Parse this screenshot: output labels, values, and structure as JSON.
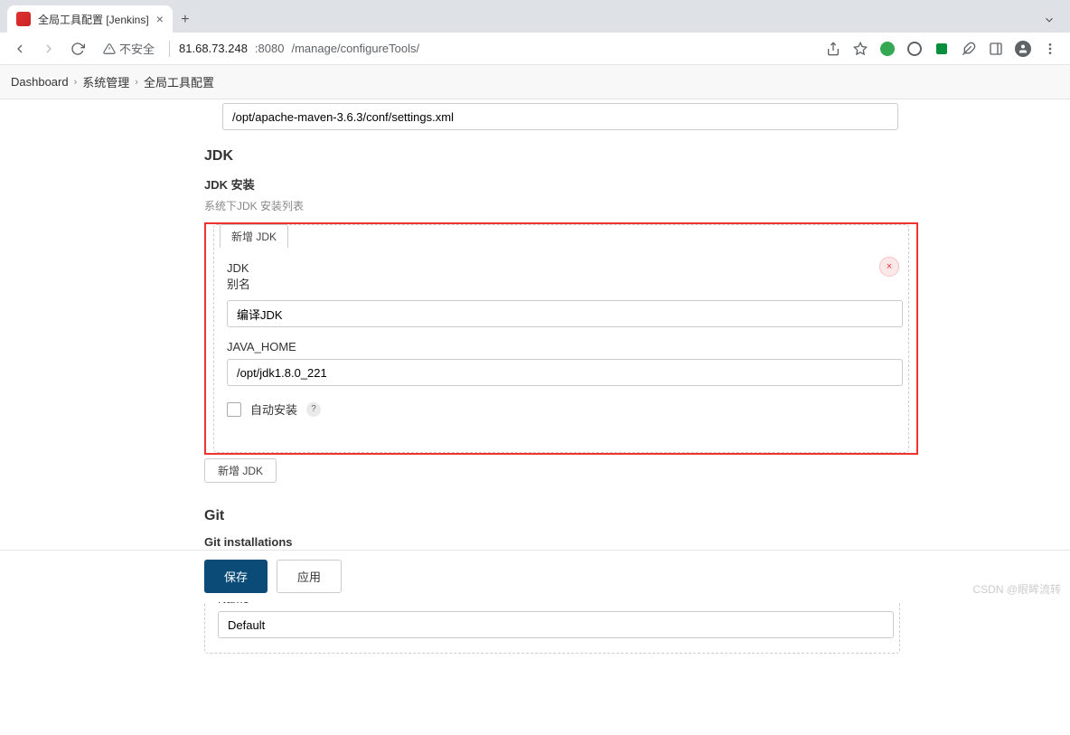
{
  "browser": {
    "tab_title": "全局工具配置 [Jenkins]",
    "security_label": "不安全",
    "url_host": "81.68.73.248",
    "url_port": ":8080",
    "url_path": "/manage/configureTools/"
  },
  "breadcrumbs": {
    "items": [
      "Dashboard",
      "系统管理",
      "全局工具配置"
    ]
  },
  "maven": {
    "settings_value": "/opt/apache-maven-3.6.3/conf/settings.xml"
  },
  "jdk": {
    "title": "JDK",
    "install_label": "JDK 安装",
    "install_desc": "系统下JDK 安装列表",
    "tab_label": "新增 JDK",
    "name_label1": "JDK",
    "name_label2": "别名",
    "name_value": "编译JDK",
    "home_label": "JAVA_HOME",
    "home_value": "/opt/jdk1.8.0_221",
    "auto_install_label": "自动安装",
    "add_btn": "新增 JDK"
  },
  "git": {
    "title": "Git",
    "install_label": "Git installations",
    "header_label": "Git",
    "name_label": "Name",
    "name_value": "Default"
  },
  "buttons": {
    "save": "保存",
    "apply": "应用"
  },
  "watermark": "CSDN @眼眸流转"
}
